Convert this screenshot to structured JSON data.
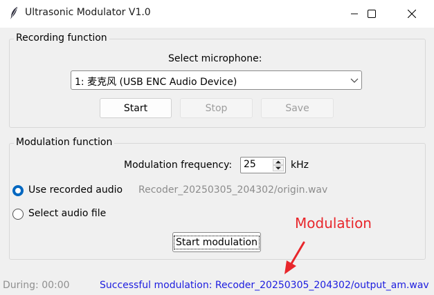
{
  "window": {
    "title": "Ultrasonic Modulator V1.0",
    "icon": "feather-icon"
  },
  "recording": {
    "group_title": "Recording function",
    "select_label": "Select microphone:",
    "microphone_value": "1: 麦克风 (USB ENC Audio Device)",
    "buttons": {
      "start": "Start",
      "stop": "Stop",
      "save": "Save"
    }
  },
  "modulation": {
    "group_title": "Modulation function",
    "frequency_label": "Modulation frequency:",
    "frequency_value": "25",
    "frequency_unit": "kHz",
    "option_recorded": "Use recorded audio",
    "recorded_path": "Recoder_20250305_204302/origin.wav",
    "option_file": "Select audio file",
    "start_button": "Start modulation",
    "selected_option": "Use recorded audio"
  },
  "status": {
    "during": "During: 00:00",
    "message": "Successful modulation: Recoder_20250305_204302/output_am.wav"
  },
  "annotation": {
    "text": "Modulation"
  },
  "colors": {
    "accent": "#0067c0",
    "status_message": "#1c1cdf",
    "annotation": "#e8262b"
  }
}
